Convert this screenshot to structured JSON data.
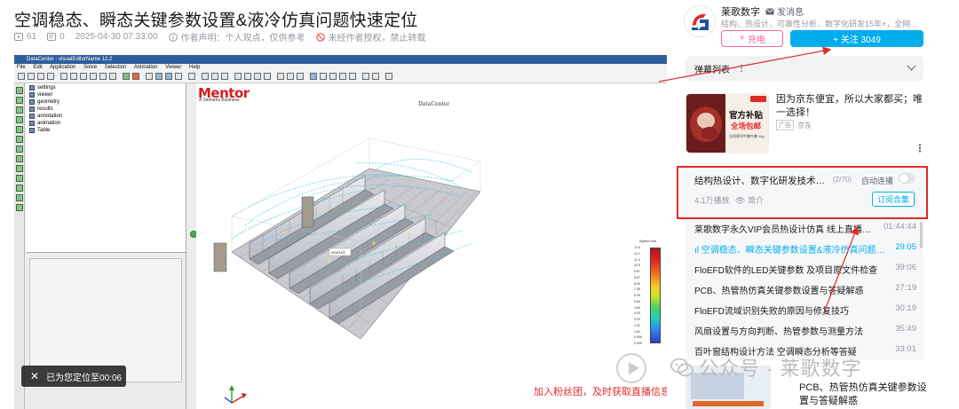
{
  "video": {
    "title": "空调稳态、瞬态关键参数设置&液冷仿真问题快速定位",
    "plays": "61",
    "danmaku_count": "0",
    "publish_time": "2025-04-30 07:33:00",
    "statement": "作者声明：个人观点，仅供参考",
    "no_repost": "未经作者授权，禁止转载"
  },
  "player": {
    "app_title": "DataCenter - visualEditorName 12.2",
    "menu": [
      "File",
      "Edit",
      "Application",
      "Solve",
      "Selection",
      "Animation",
      "Viewer",
      "Help"
    ],
    "tree": [
      "settings",
      "viewer",
      "geometry",
      "results",
      "annotation",
      "animation",
      "Table"
    ],
    "logo_text": "Mentor",
    "logo_sub": "A Siemens Business",
    "model_label": "DataCenter",
    "speed_label": "Speed  m/s",
    "colorbar_ticks": [
      "12.9",
      "12.1",
      "11.3",
      "10.5",
      "9.67",
      "8.87",
      "8.06",
      "7.26",
      "6.45",
      "5.64",
      "4.84",
      "4.03",
      "3.22",
      "2.42",
      "1.61",
      "0.806",
      "0.000"
    ],
    "toast": "已为您定位至00:06",
    "follow_hint": "加入粉丝团，及时获取直播信息"
  },
  "uploader": {
    "name": "莱歌数字",
    "message": "发消息",
    "desc": "结构、热设计、可靠性分析、数字化研发15年+，全网…",
    "charge_label": "充电",
    "follow_label": "+ 关注 3049"
  },
  "danmaku": {
    "label": "弹幕列表",
    "more": "⋮"
  },
  "ad": {
    "title": "因为京东便宜，所以大家都买；唯一选择！",
    "tag": "广告",
    "source": "京东",
    "badge_line1": "官方补贴",
    "badge_line2": "全场包邮",
    "badge_line3": "谷饲原切牛腩牛腩 1kg"
  },
  "playlist": {
    "title": "结构热设计、数字化研发技术…",
    "count": "(2/70)",
    "autoplay": "自动连播",
    "plays": "4.1万播放",
    "intro": "简介",
    "subscribe": "订阅合集",
    "episodes": [
      {
        "title": "莱歌数字永久VIP会员热设计仿真 线上直播…",
        "duration": "01:44:44"
      },
      {
        "title": "空调稳态、瞬态关键参数设置&液冷仿真问题…",
        "duration": "29:05"
      },
      {
        "title": "FloEFD软件的LED关键参数 及项目原文件检查",
        "duration": "39:06"
      },
      {
        "title": "PCB、热管热仿真关键参数设置与答疑解惑",
        "duration": "27:19"
      },
      {
        "title": "FloEFD流域识别失败的原因与修复技巧",
        "duration": "30:19"
      },
      {
        "title": "风扇设置与方向判断、热管参数与测量方法",
        "duration": "35:49"
      },
      {
        "title": "百叶窗结构设计方法 空调瞬态分析等答疑",
        "duration": "33:01"
      }
    ]
  },
  "recommend": {
    "title": "PCB、热管热仿真关键参数设置与答疑解惑"
  },
  "watermark": {
    "text": "公众号 · 莱歌数字"
  },
  "colors": {
    "accent": "#00aeec",
    "pink": "#ff6699",
    "annotation_red": "#e02b2b"
  }
}
